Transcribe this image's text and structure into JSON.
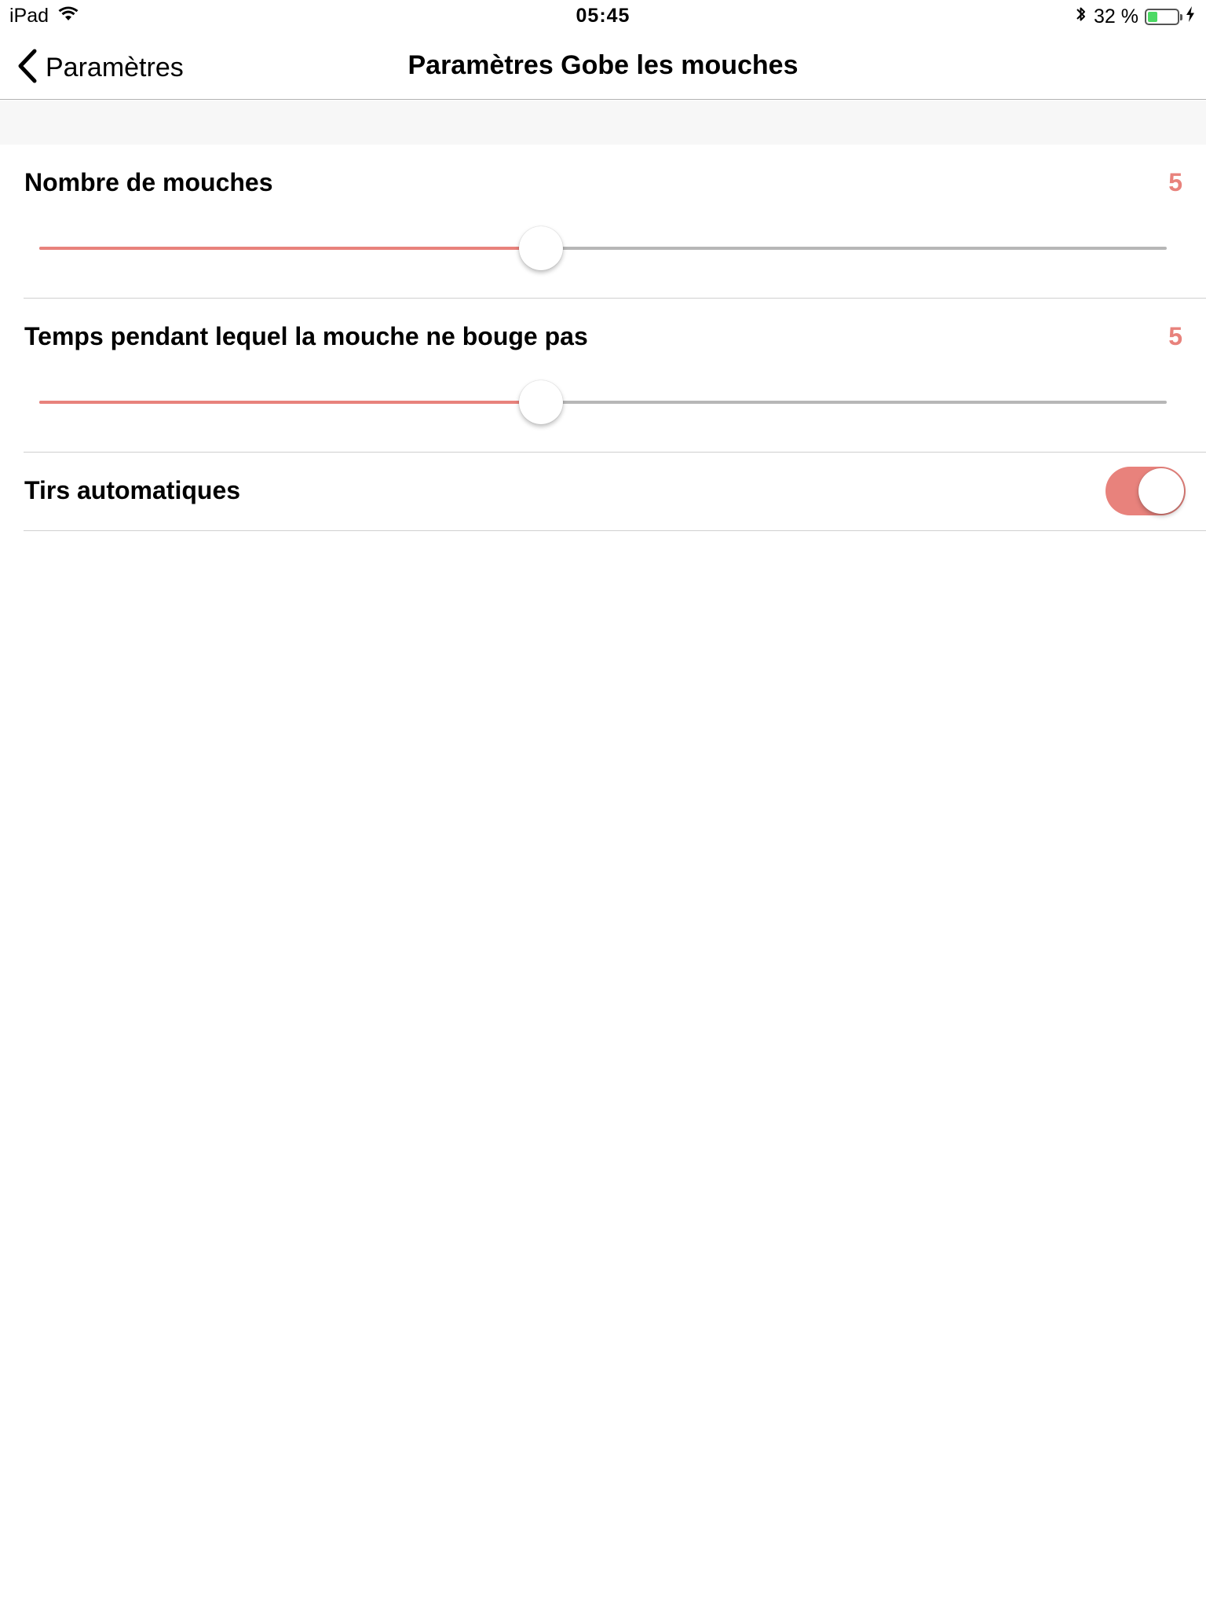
{
  "status_bar": {
    "device": "iPad",
    "time": "05:45",
    "battery_percent_label": "32 %",
    "battery_level": 0.32,
    "battery_color": "#4cd964"
  },
  "nav": {
    "back_label": "Paramètres",
    "title": "Paramètres Gobe les mouches"
  },
  "accent_color": "#e8827c",
  "settings": {
    "flies_count": {
      "label": "Nombre de mouches",
      "value": "5",
      "fraction": 0.445
    },
    "fly_still_time": {
      "label": "Temps pendant lequel la mouche ne bouge pas",
      "value": "5",
      "fraction": 0.445
    },
    "auto_fire": {
      "label": "Tirs automatiques",
      "on": true
    }
  },
  "icons": {
    "wifi": "wifi-icon",
    "bluetooth": "bluetooth-icon",
    "battery": "battery-icon",
    "charging": "charging-bolt-icon",
    "back": "chevron-left-icon"
  }
}
